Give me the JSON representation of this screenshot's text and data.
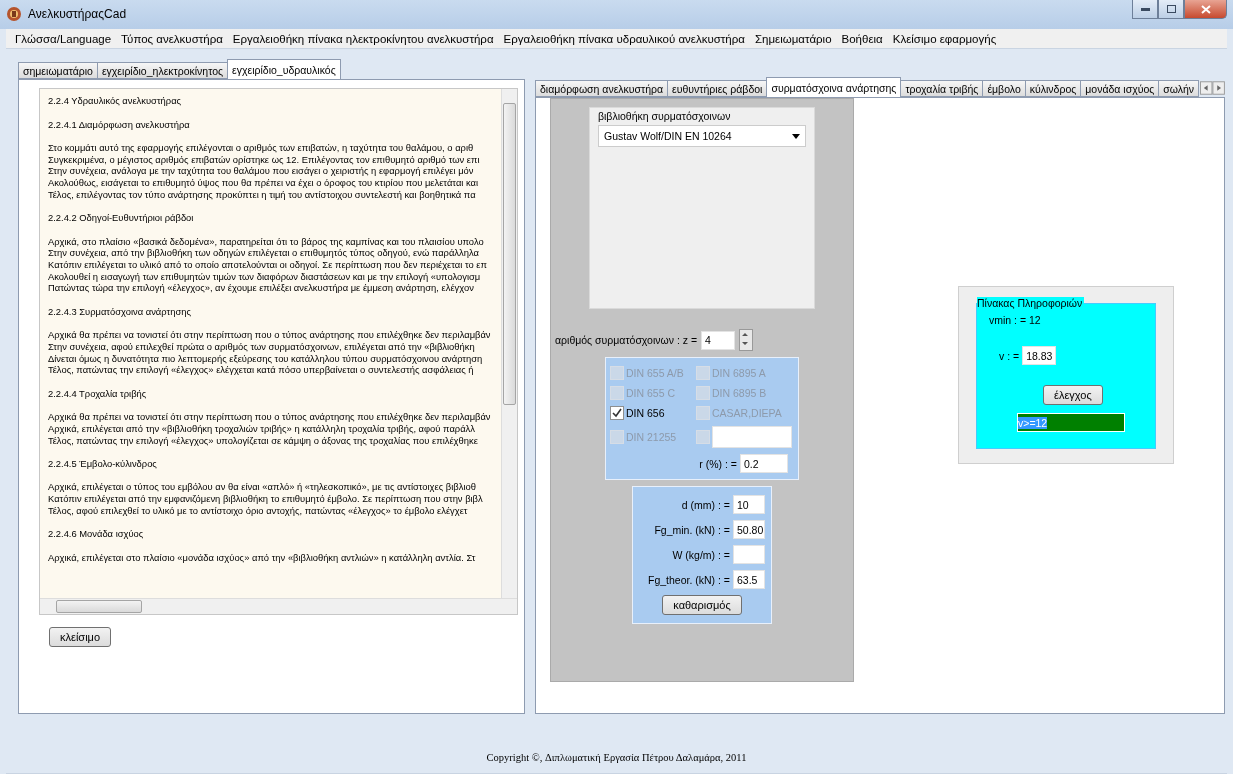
{
  "window": {
    "title": "ΑνελκυστήραςCad"
  },
  "menu": [
    "Γλώσσα/Language",
    "Τύπος ανελκυστήρα",
    "Εργαλειοθήκη πίνακα ηλεκτροκίνητου ανελκυστήρα",
    "Εργαλειοθήκη πίνακα υδραυλικού ανελκυστήρα",
    "Σημειωματάριο",
    "Βοήθεια",
    "Κλείσιμο εφαρμογής"
  ],
  "left_tabs": [
    {
      "label": "σημειωματάριο",
      "selected": false
    },
    {
      "label": "εγχειρίδιο_ηλεκτροκίνητος",
      "selected": false
    },
    {
      "label": "εγχειρίδιο_υδραυλικός",
      "selected": true
    }
  ],
  "manual": {
    "title": "2.2.4 Υδραυλικός ανελκυστήρας",
    "sections": [
      {
        "heading": "2.2.4.1 Διαμόρφωση ανελκυστήρα",
        "lines": [
          "Στο κομμάτι αυτό της εφαρμογής επιλέγονται ο αριθμός των επιβατών, η ταχύτητα του θαλάμου, ο αριθ",
          "Συγκεκριμένα, ο μέγιστος αριθμός επιβατών ορίστηκε ως 12. Επιλέγοντας τον επιθυμητό αριθμό των επι",
          "Στην συνέχεια, ανάλογα με την ταχύτητα του θαλάμου που εισάγει ο χειριστής η εφαρμογή επιλέγει μόν",
          "Ακολούθως, εισάγεται το επιθυμητό ύψος που θα πρέπει να έχει ο όροφος του κτιρίου που μελετάται και",
          "Τέλος, επιλέγοντας τον τύπο ανάρτησης προκύπτει η τιμή του αντίστοιχου συντελεστή και βοηθητικά πα"
        ]
      },
      {
        "heading": "2.2.4.2 Οδηγοί-Ευθυντήριοι ράβδοι",
        "lines": [
          "Αρχικά, στο πλαίσιο «βασικά δεδομένα», παρατηρείται ότι το βάρος της καμπίνας και του πλαισίου υπολο",
          "Στην συνέχεια, από την βιβλιοθήκη των οδηγών επιλέγεται ο επιθυμητός τύπος οδηγού, ενώ παράλληλα",
          "Κατόπιν επιλέγεται το υλικό από το οποίο αποτελούνται οι οδηγοί. Σε περίπτωση που δεν περιέχεται το επ",
          "Ακολουθεί η εισαγωγή των επιθυμητών τιμών των διαφόρων διαστάσεων και με την επιλογή «υπολογισμ",
          "Πατώντας τώρα την επιλογή «έλεγχος», αν έχουμε επιλέξει ανελκυστήρα με έμμεση ανάρτηση, ελέγχον"
        ]
      },
      {
        "heading": "2.2.4.3 Συρματόσχοινα ανάρτησης",
        "lines": [
          "Αρχικά θα πρέπει να τονιστεί ότι στην περίπτωση που ο τύπος ανάρτησης που επιλέχθηκε δεν περιλαμβάν",
          "Στην συνέχεια, αφού επιλεχθεί πρώτα ο αριθμός των συρματόσχοινων, επιλέγεται από την «βιβλιοθήκη",
          "Δίνεται όμως η δυνατότητα πιο λεπτομερής εξεύρεσης του κατάλληλου τύπου συρματόσχοινου ανάρτηση",
          "Τέλος, πατώντας την επιλογή «έλεγχος» ελέγχεται κατά πόσο υπερβαίνεται ο συντελεστής ασφάλειας ή"
        ]
      },
      {
        "heading": "2.2.4.4 Τροχαλία τριβής",
        "lines": [
          "Αρχικά θα πρέπει να τονιστεί ότι στην περίπτωση που ο τύπος ανάρτησης που επιλέχθηκε δεν περιλαμβάν",
          "Αρχικά, επιλέγεται από την «βιβλιοθήκη τροχαλιών τριβής» η κατάλληλη τροχαλία τριβής, αφού παράλλ",
          "Τέλος, πατώντας την επιλογή «έλεγχος» υπολογίζεται σε κάμψη ο άξονας της τροχαλίας που επιλέχθηκε"
        ]
      },
      {
        "heading": "2.2.4.5 Έμβολο-κύλινδρος",
        "lines": [
          "Αρχικά, επιλέγεται ο τύπος του εμβόλου αν θα είναι «απλό» ή «τηλεσκοπικό», με τις αντίστοιχες βιβλιοθ",
          "Κατόπιν επιλέγεται από την εμφανιζόμενη βιβλιοθήκη το επιθυμητό έμβολο. Σε περίπτωση που στην βιβλ",
          "Τέλος, αφού επιλεχθεί το υλικό με το αντίστοιχο όριο αντοχής, πατώντας «έλεγχος» το έμβολο ελέγχετ"
        ]
      },
      {
        "heading": "2.2.4.6 Μονάδα ισχύος",
        "lines": [
          "Αρχικά, επιλέγεται στο πλαίσιο «μονάδα ισχύος» από την «βιβλιοθήκη αντλιών» η κατάλληλη αντλία. Στ"
        ]
      }
    ]
  },
  "close_button": "κλείσιμο",
  "right_tabs": [
    {
      "label": "διαμόρφωση ανελκυστήρα",
      "selected": false
    },
    {
      "label": "ευθυντήριες ράβδοι",
      "selected": false
    },
    {
      "label": "συρματόσχοινα ανάρτησης",
      "selected": true
    },
    {
      "label": "τροχαλία τριβής",
      "selected": false
    },
    {
      "label": "έμβολο",
      "selected": false
    },
    {
      "label": "κύλινδρος",
      "selected": false
    },
    {
      "label": "μονάδα ισχύος",
      "selected": false
    },
    {
      "label": "σωλήν",
      "selected": false
    }
  ],
  "library": {
    "legend": "βιβλιοθήκη συρματόσχοινων",
    "value": "Gustav Wolf/DIN EN 10264"
  },
  "rope_count": {
    "label": "αριθμός συρματόσχοινων : z =",
    "value": "4"
  },
  "rope_types": [
    {
      "kind": "label",
      "label": "DIN 655 A/B",
      "checked": false,
      "disabled": true
    },
    {
      "kind": "label",
      "label": "DIN 6895 A",
      "checked": false,
      "disabled": true
    },
    {
      "kind": "label",
      "label": "DIN 655 C",
      "checked": false,
      "disabled": true
    },
    {
      "kind": "label",
      "label": "DIN 6895 B",
      "checked": false,
      "disabled": true
    },
    {
      "kind": "label",
      "label": "DIN 656",
      "checked": true,
      "disabled": false
    },
    {
      "kind": "label",
      "label": "CASAR,DIEPA",
      "checked": false,
      "disabled": true
    },
    {
      "kind": "label",
      "label": "DIN 21255",
      "checked": false,
      "disabled": true
    },
    {
      "kind": "field",
      "checked": false,
      "disabled": true
    }
  ],
  "r_field": {
    "label": "r (%) : =",
    "value": "0.2"
  },
  "results": [
    {
      "label": "d (mm) : =",
      "value": "10"
    },
    {
      "label": "Fg_min. (kN) : =",
      "value": "50.80"
    },
    {
      "label": "W (kg/m) : ="
    },
    {
      "label": "Fg_theor. (kN) : =",
      "value": "63.5"
    }
  ],
  "clear_button": "καθαρισμός",
  "info": {
    "legend": "Πίνακας Πληροφοριών",
    "vmin": "vmin : = 12",
    "v_label": "v : =",
    "v_value": "18.83",
    "check_button": "έλεγχος",
    "result": "v>=12",
    "passed": true
  },
  "copyright": "Copyright ©, Διπλωματική Εργασία Πέτρου Δαλαμάρα, 2011"
}
